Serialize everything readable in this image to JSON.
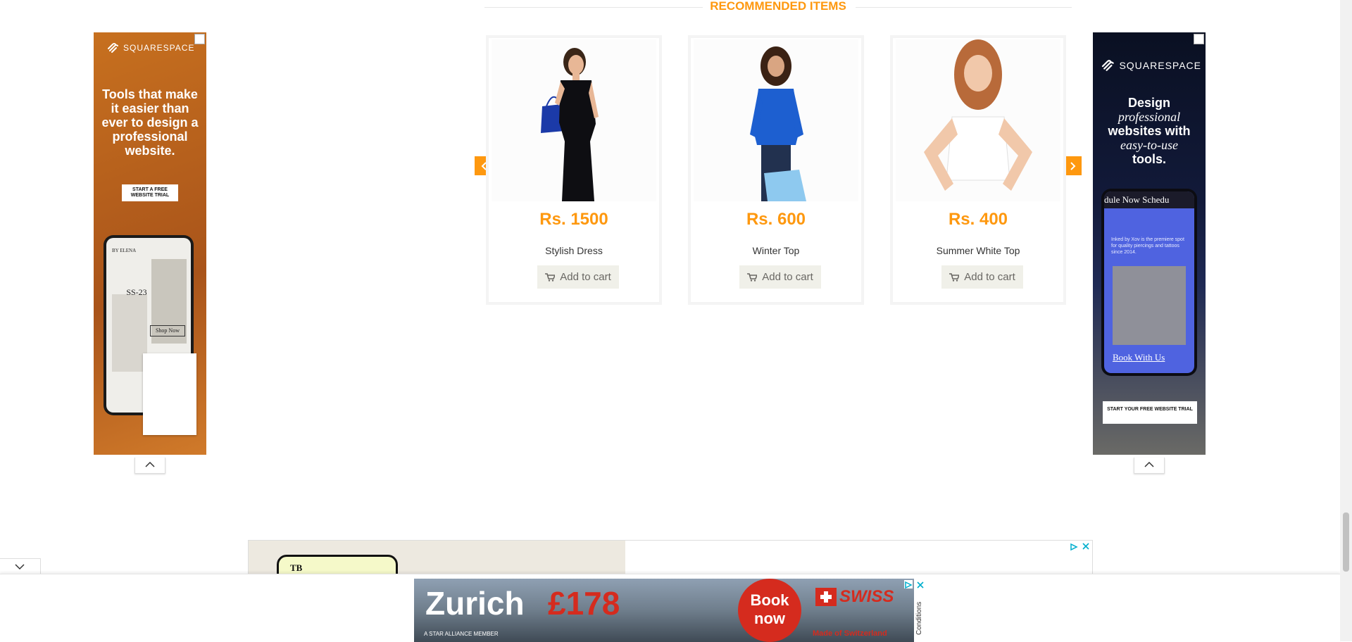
{
  "section": {
    "title": "RECOMMENDED ITEMS"
  },
  "products": [
    {
      "price": "Rs. 1500",
      "name": "Stylish Dress",
      "cart_label": "Add to cart"
    },
    {
      "price": "Rs. 600",
      "name": "Winter Top",
      "cart_label": "Add to cart"
    },
    {
      "price": "Rs. 400",
      "name": "Summer White Top",
      "cart_label": "Add to cart"
    }
  ],
  "carousel": {
    "prev_icon": "chevron-left-icon",
    "next_icon": "chevron-right-icon"
  },
  "left_ad": {
    "brand": "SQUARESPACE",
    "headline": "Tools that make it easier than ever to design a professional website.",
    "cta": "START A FREE WEBSITE TRIAL",
    "phone_brand": "BY ELENA",
    "phone_text": "SS-23",
    "phone_button": "Shop Now"
  },
  "right_ad": {
    "brand": "SQUARESPACE",
    "headline_1": "Design",
    "headline_2": "professional",
    "headline_3": "websites with",
    "headline_4": "easy-to-use",
    "headline_5": "tools.",
    "phone_header": "dule Now   Schedu",
    "phone_body": "Inked by Xov is the premiere spot for quality piercings and tattoos since 2014.",
    "phone_link": "Book With Us",
    "cta": "START YOUR FREE WEBSITE TRIAL"
  },
  "bottom_ad": {
    "city": "Zurich",
    "price": "£178",
    "cta": "Book now",
    "brand": "SWISS",
    "footer_left": "A STAR ALLIANCE MEMBER",
    "footer_right": "Made of Switzerland",
    "conditions": "Conditions"
  },
  "mid_ad": {
    "partial_text": "TB"
  },
  "colors": {
    "accent": "#FE980F",
    "squarespace_orange": "#B8601A",
    "squarespace_dark": "#0B1226",
    "swiss_red": "#D52B1E"
  }
}
